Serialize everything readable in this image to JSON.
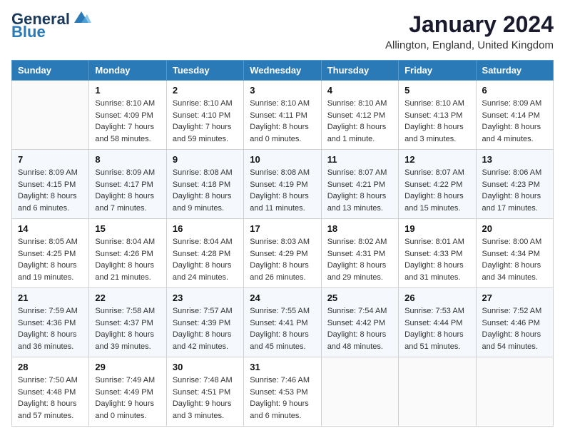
{
  "logo": {
    "line1": "General",
    "line2": "Blue"
  },
  "title": "January 2024",
  "location": "Allington, England, United Kingdom",
  "weekdays": [
    "Sunday",
    "Monday",
    "Tuesday",
    "Wednesday",
    "Thursday",
    "Friday",
    "Saturday"
  ],
  "weeks": [
    [
      {
        "day": "",
        "sunrise": "",
        "sunset": "",
        "daylight": ""
      },
      {
        "day": "1",
        "sunrise": "Sunrise: 8:10 AM",
        "sunset": "Sunset: 4:09 PM",
        "daylight": "Daylight: 7 hours and 58 minutes."
      },
      {
        "day": "2",
        "sunrise": "Sunrise: 8:10 AM",
        "sunset": "Sunset: 4:10 PM",
        "daylight": "Daylight: 7 hours and 59 minutes."
      },
      {
        "day": "3",
        "sunrise": "Sunrise: 8:10 AM",
        "sunset": "Sunset: 4:11 PM",
        "daylight": "Daylight: 8 hours and 0 minutes."
      },
      {
        "day": "4",
        "sunrise": "Sunrise: 8:10 AM",
        "sunset": "Sunset: 4:12 PM",
        "daylight": "Daylight: 8 hours and 1 minute."
      },
      {
        "day": "5",
        "sunrise": "Sunrise: 8:10 AM",
        "sunset": "Sunset: 4:13 PM",
        "daylight": "Daylight: 8 hours and 3 minutes."
      },
      {
        "day": "6",
        "sunrise": "Sunrise: 8:09 AM",
        "sunset": "Sunset: 4:14 PM",
        "daylight": "Daylight: 8 hours and 4 minutes."
      }
    ],
    [
      {
        "day": "7",
        "sunrise": "Sunrise: 8:09 AM",
        "sunset": "Sunset: 4:15 PM",
        "daylight": "Daylight: 8 hours and 6 minutes."
      },
      {
        "day": "8",
        "sunrise": "Sunrise: 8:09 AM",
        "sunset": "Sunset: 4:17 PM",
        "daylight": "Daylight: 8 hours and 7 minutes."
      },
      {
        "day": "9",
        "sunrise": "Sunrise: 8:08 AM",
        "sunset": "Sunset: 4:18 PM",
        "daylight": "Daylight: 8 hours and 9 minutes."
      },
      {
        "day": "10",
        "sunrise": "Sunrise: 8:08 AM",
        "sunset": "Sunset: 4:19 PM",
        "daylight": "Daylight: 8 hours and 11 minutes."
      },
      {
        "day": "11",
        "sunrise": "Sunrise: 8:07 AM",
        "sunset": "Sunset: 4:21 PM",
        "daylight": "Daylight: 8 hours and 13 minutes."
      },
      {
        "day": "12",
        "sunrise": "Sunrise: 8:07 AM",
        "sunset": "Sunset: 4:22 PM",
        "daylight": "Daylight: 8 hours and 15 minutes."
      },
      {
        "day": "13",
        "sunrise": "Sunrise: 8:06 AM",
        "sunset": "Sunset: 4:23 PM",
        "daylight": "Daylight: 8 hours and 17 minutes."
      }
    ],
    [
      {
        "day": "14",
        "sunrise": "Sunrise: 8:05 AM",
        "sunset": "Sunset: 4:25 PM",
        "daylight": "Daylight: 8 hours and 19 minutes."
      },
      {
        "day": "15",
        "sunrise": "Sunrise: 8:04 AM",
        "sunset": "Sunset: 4:26 PM",
        "daylight": "Daylight: 8 hours and 21 minutes."
      },
      {
        "day": "16",
        "sunrise": "Sunrise: 8:04 AM",
        "sunset": "Sunset: 4:28 PM",
        "daylight": "Daylight: 8 hours and 24 minutes."
      },
      {
        "day": "17",
        "sunrise": "Sunrise: 8:03 AM",
        "sunset": "Sunset: 4:29 PM",
        "daylight": "Daylight: 8 hours and 26 minutes."
      },
      {
        "day": "18",
        "sunrise": "Sunrise: 8:02 AM",
        "sunset": "Sunset: 4:31 PM",
        "daylight": "Daylight: 8 hours and 29 minutes."
      },
      {
        "day": "19",
        "sunrise": "Sunrise: 8:01 AM",
        "sunset": "Sunset: 4:33 PM",
        "daylight": "Daylight: 8 hours and 31 minutes."
      },
      {
        "day": "20",
        "sunrise": "Sunrise: 8:00 AM",
        "sunset": "Sunset: 4:34 PM",
        "daylight": "Daylight: 8 hours and 34 minutes."
      }
    ],
    [
      {
        "day": "21",
        "sunrise": "Sunrise: 7:59 AM",
        "sunset": "Sunset: 4:36 PM",
        "daylight": "Daylight: 8 hours and 36 minutes."
      },
      {
        "day": "22",
        "sunrise": "Sunrise: 7:58 AM",
        "sunset": "Sunset: 4:37 PM",
        "daylight": "Daylight: 8 hours and 39 minutes."
      },
      {
        "day": "23",
        "sunrise": "Sunrise: 7:57 AM",
        "sunset": "Sunset: 4:39 PM",
        "daylight": "Daylight: 8 hours and 42 minutes."
      },
      {
        "day": "24",
        "sunrise": "Sunrise: 7:55 AM",
        "sunset": "Sunset: 4:41 PM",
        "daylight": "Daylight: 8 hours and 45 minutes."
      },
      {
        "day": "25",
        "sunrise": "Sunrise: 7:54 AM",
        "sunset": "Sunset: 4:42 PM",
        "daylight": "Daylight: 8 hours and 48 minutes."
      },
      {
        "day": "26",
        "sunrise": "Sunrise: 7:53 AM",
        "sunset": "Sunset: 4:44 PM",
        "daylight": "Daylight: 8 hours and 51 minutes."
      },
      {
        "day": "27",
        "sunrise": "Sunrise: 7:52 AM",
        "sunset": "Sunset: 4:46 PM",
        "daylight": "Daylight: 8 hours and 54 minutes."
      }
    ],
    [
      {
        "day": "28",
        "sunrise": "Sunrise: 7:50 AM",
        "sunset": "Sunset: 4:48 PM",
        "daylight": "Daylight: 8 hours and 57 minutes."
      },
      {
        "day": "29",
        "sunrise": "Sunrise: 7:49 AM",
        "sunset": "Sunset: 4:49 PM",
        "daylight": "Daylight: 9 hours and 0 minutes."
      },
      {
        "day": "30",
        "sunrise": "Sunrise: 7:48 AM",
        "sunset": "Sunset: 4:51 PM",
        "daylight": "Daylight: 9 hours and 3 minutes."
      },
      {
        "day": "31",
        "sunrise": "Sunrise: 7:46 AM",
        "sunset": "Sunset: 4:53 PM",
        "daylight": "Daylight: 9 hours and 6 minutes."
      },
      {
        "day": "",
        "sunrise": "",
        "sunset": "",
        "daylight": ""
      },
      {
        "day": "",
        "sunrise": "",
        "sunset": "",
        "daylight": ""
      },
      {
        "day": "",
        "sunrise": "",
        "sunset": "",
        "daylight": ""
      }
    ]
  ]
}
